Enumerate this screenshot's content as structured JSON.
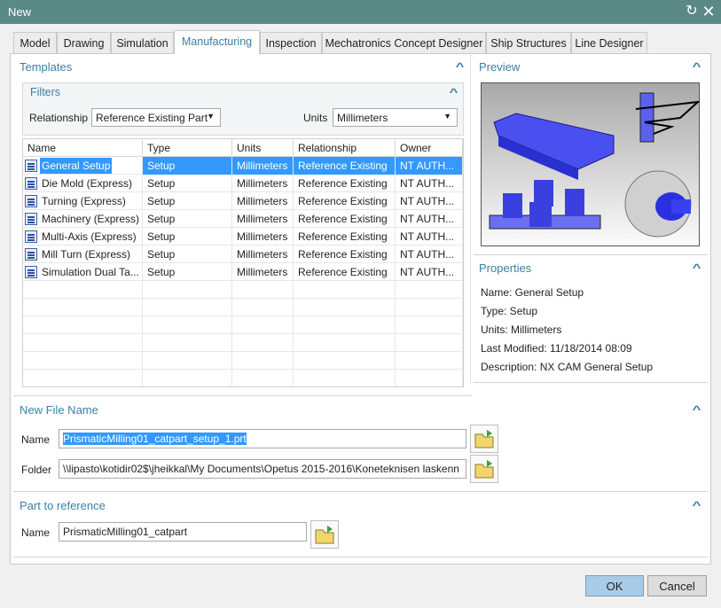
{
  "window": {
    "title": "New"
  },
  "tabs": [
    {
      "label": "Model"
    },
    {
      "label": "Drawing"
    },
    {
      "label": "Simulation"
    },
    {
      "label": "Manufacturing",
      "active": true
    },
    {
      "label": "Inspection"
    },
    {
      "label": "Mechatronics Concept Designer"
    },
    {
      "label": "Ship Structures"
    },
    {
      "label": "Line Designer"
    }
  ],
  "templates": {
    "title": "Templates",
    "filters": {
      "title": "Filters",
      "relationship_label": "Relationship",
      "relationship_value": "Reference Existing Part",
      "units_label": "Units",
      "units_value": "Millimeters"
    },
    "columns": [
      "Name",
      "Type",
      "Units",
      "Relationship",
      "Owner"
    ],
    "rows": [
      [
        "General Setup",
        "Setup",
        "Millimeters",
        "Reference Existing",
        "NT AUTH..."
      ],
      [
        "Die Mold (Express)",
        "Setup",
        "Millimeters",
        "Reference Existing",
        "NT AUTH..."
      ],
      [
        "Turning (Express)",
        "Setup",
        "Millimeters",
        "Reference Existing",
        "NT AUTH..."
      ],
      [
        "Machinery (Express)",
        "Setup",
        "Millimeters",
        "Reference Existing",
        "NT AUTH..."
      ],
      [
        "Multi-Axis (Express)",
        "Setup",
        "Millimeters",
        "Reference Existing",
        "NT AUTH..."
      ],
      [
        "Mill Turn (Express)",
        "Setup",
        "Millimeters",
        "Reference Existing",
        "NT AUTH..."
      ],
      [
        "Simulation Dual Ta...",
        "Setup",
        "Millimeters",
        "Reference Existing",
        "NT AUTH..."
      ]
    ],
    "selected_row": 0
  },
  "preview": {
    "title": "Preview"
  },
  "properties": {
    "title": "Properties",
    "lines": [
      "Name: General Setup",
      "Type: Setup",
      "Units: Millimeters",
      "Last Modified: 11/18/2014 08:09",
      "Description: NX CAM General Setup"
    ]
  },
  "new_file": {
    "title": "New File Name",
    "name_label": "Name",
    "name_value": "PrismaticMilling01_catpart_setup_1.prt",
    "folder_label": "Folder",
    "folder_value": "\\\\lipasto\\kotidir02$\\jheikkal\\My Documents\\Opetus 2015-2016\\Koneteknisen laskenn"
  },
  "part_ref": {
    "title": "Part to reference",
    "name_label": "Name",
    "name_value": "PrismaticMilling01_catpart"
  },
  "buttons": {
    "ok": "OK",
    "cancel": "Cancel"
  },
  "colors": {
    "title_bar": "#5b8985",
    "accent": "#3b7fa6",
    "selection": "#3399ff"
  }
}
